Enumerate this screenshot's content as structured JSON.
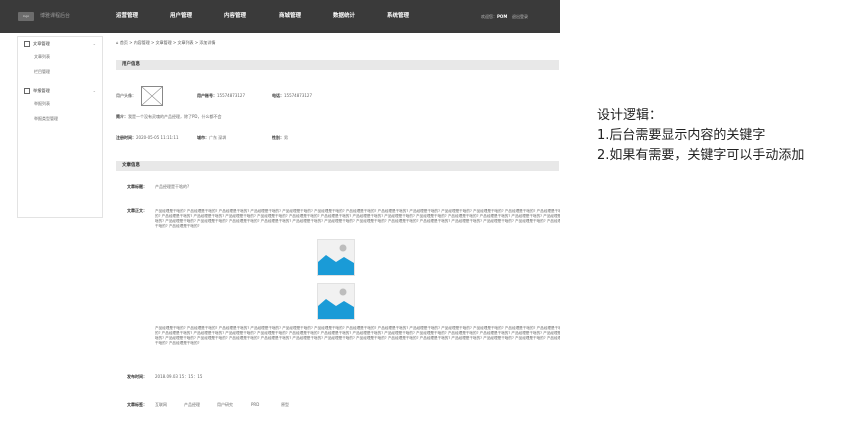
{
  "topbar": {
    "logo_text": "logo",
    "brand": "博雅课程后台",
    "nav": [
      "运营管理",
      "用户管理",
      "内容管理",
      "商城管理",
      "数据统计",
      "系统管理"
    ],
    "user_prefix": "欢迎您：",
    "user_name": "POM",
    "logout": "退出登录"
  },
  "sidebar": {
    "groups": [
      {
        "label": "文章管理",
        "items": [
          "文章列表",
          "栏目管理"
        ]
      },
      {
        "label": "举报管理",
        "items": [
          "举报列表",
          "举报类型管理"
        ]
      }
    ]
  },
  "breadcrumb": "首页 > 内容管理 > 文章管理 > 文章列表 > 添加详情",
  "user_section": {
    "title": "用户信息",
    "avatar_label": "用户头像：",
    "account_label": "用户账号：",
    "account_value": "15574873127",
    "phone_label": "电话：",
    "phone_value": "15574873127",
    "intro_label": "简介：",
    "intro_value": "我是一个没有灵魂的产品经理，除了PD，什么都不会",
    "reg_label": "注册时间：",
    "reg_value": "2020-05-05 11:11:11",
    "region_label": "城市：",
    "region_value": "广东 深圳",
    "gender_label": "性别：",
    "gender_value": "男"
  },
  "article_section": {
    "title": "文章信息",
    "heading_label": "文章标题：",
    "heading_value": "产品经理是干啥的?",
    "body_label": "文章正文：",
    "body_text_1": "产品经理是干啥的? 产品经理是干啥的? 产品经理是干啥的? 产品经理是干啥的? 产品经理是干啥的? 产品经理是干啥的? 产品经理是干啥的? 产品经理是干啥的? 产品经理是干啥的? 产品经理是干啥的? 产品经理是干啥的? 产品经理是干啥的? 产品经理是干啥的? 产品经理是干啥的? 产品经理是干啥的? 产品经理是干啥的? 产品经理是干啥的? 产品经理是干啥的? 产品经理是干啥的? 产品经理是干啥的? 产品经理是干啥的? 产品经理是干啥的? 产品经理是干啥的? 产品经理是干啥的? 产品经理是干啥的? 产品经理是干啥的? 产品经理是干啥的? 产品经理是干啥的? 产品经理是干啥的? 产品经理是干啥的? 产品经理是干啥的? 产品经理是干啥的? 产品经理是干啥的? 产品经理是干啥的? 产品经理是干啥的? 产品经理是干啥的? 产品经理是干啥的? 产品经理是干啥的? 产品经理是干啥的? 产品经理是干啥的?",
    "body_text_2": "产品经理是干啥的? 产品经理是干啥的? 产品经理是干啥的? 产品经理是干啥的? 产品经理是干啥的? 产品经理是干啥的? 产品经理是干啥的? 产品经理是干啥的? 产品经理是干啥的? 产品经理是干啥的? 产品经理是干啥的? 产品经理是干啥的? 产品经理是干啥的? 产品经理是干啥的? 产品经理是干啥的? 产品经理是干啥的? 产品经理是干啥的? 产品经理是干啥的? 产品经理是干啥的? 产品经理是干啥的? 产品经理是干啥的? 产品经理是干啥的? 产品经理是干啥的? 产品经理是干啥的? 产品经理是干啥的? 产品经理是干啥的? 产品经理是干啥的? 产品经理是干啥的? 产品经理是干啥的? 产品经理是干啥的? 产品经理是干啥的? 产品经理是干啥的? 产品经理是干啥的? 产品经理是干啥的? 产品经理是干啥的? 产品经理是干啥的? 产品经理是干啥的? 产品经理是干啥的? 产品经理是干啥的? 产品经理是干啥的?",
    "time_label": "发布时间：",
    "time_value": "2018.09.03  15：15：15",
    "tags_label": "文章标签：",
    "tags": [
      "互联网",
      "产品经理",
      "用户研究",
      "PRD",
      "原型"
    ]
  },
  "notes": {
    "title": "设计逻辑：",
    "line1": "1.后台需要显示内容的关键字",
    "line2": "2.如果有需要，关键字可以手动添加"
  },
  "colors": {
    "topbar": "#3a3a3a",
    "section_bar": "#e8e8e8",
    "image_blue": "#1a9bd7"
  }
}
